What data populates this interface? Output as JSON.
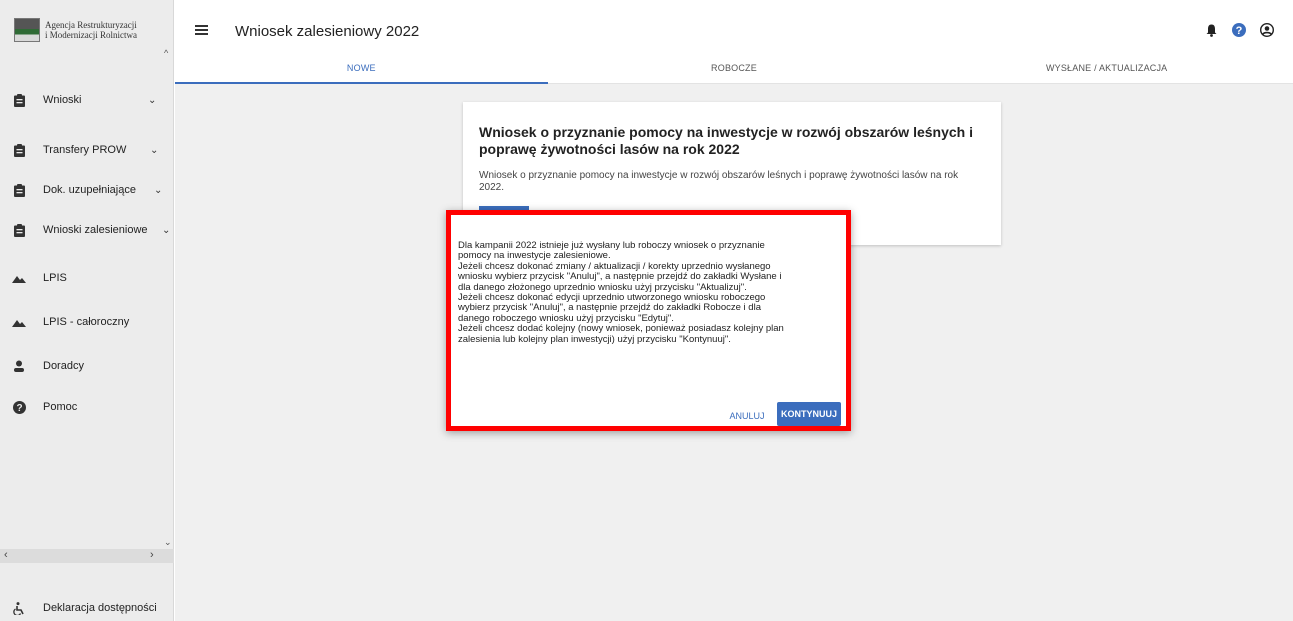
{
  "sidebar": {
    "logo_line1": "Agencja Restrukturyzacji",
    "logo_line2": "i Modernizacji Rolnictwa",
    "items": [
      {
        "label": "Wnioski",
        "icon": "clipboard-icon",
        "chevron": "⌄"
      },
      {
        "label": "Transfery PROW",
        "icon": "clipboard-icon",
        "chevron": "⌄"
      },
      {
        "label": "Dok. uzupełniające",
        "icon": "clipboard-icon",
        "chevron": "⌄"
      },
      {
        "label": "Wnioski zalesieniowe",
        "icon": "clipboard-icon",
        "chevron": "⌄"
      },
      {
        "label": "LPIS",
        "icon": "landscape-icon"
      },
      {
        "label": "LPIS - całoroczny",
        "icon": "landscape-icon"
      },
      {
        "label": "Doradcy",
        "icon": "person-icon"
      },
      {
        "label": "Pomoc",
        "icon": "help-icon"
      }
    ],
    "footer_label": "Deklaracja dostępności"
  },
  "header": {
    "title": "Wniosek zalesieniowy 2022"
  },
  "tabs": [
    {
      "label": "NOWE",
      "active": true
    },
    {
      "label": "ROBOCZE",
      "active": false
    },
    {
      "label": "WYSŁANE / AKTUALIZACJA",
      "active": false
    }
  ],
  "card": {
    "title": "Wniosek o przyznanie pomocy na inwestycje w rozwój obszarów leśnych i poprawę żywotności lasów na rok 2022",
    "description": "Wniosek o przyznanie pomocy na inwestycje w rozwój obszarów leśnych i poprawę żywotności lasów na rok 2022."
  },
  "dialog": {
    "lines": [
      "Dla kampanii 2022 istnieje już wysłany lub roboczy wniosek o przyznanie",
      "pomocy na inwestycje zalesieniowe.",
      "Jeżeli chcesz dokonać zmiany / aktualizacji / korekty uprzednio wysłanego",
      "wniosku wybierz przycisk \"Anuluj\", a następnie przejdź do zakładki Wysłane i",
      "dla danego złożonego uprzednio wniosku użyj przycisku \"Aktualizuj\".",
      "Jeżeli chcesz dokonać edycji uprzednio utworzonego wniosku roboczego",
      "wybierz przycisk \"Anuluj\", a następnie przejdź do zakładki Robocze i dla",
      "danego roboczego wniosku użyj przycisku \"Edytuj\".",
      "Jeżeli chcesz dodać kolejny (nowy wniosek, ponieważ posiadasz kolejny plan",
      "zalesienia lub kolejny plan inwestycji) użyj przycisku \"Kontynuuj\"."
    ],
    "cancel_label": "ANULUJ",
    "continue_label": "KONTYNUUJ"
  },
  "colors": {
    "accent": "#3b6dbd",
    "highlight_border": "#ff0000",
    "sidebar_bg": "#ececec",
    "content_bg": "#f0f0f0"
  }
}
